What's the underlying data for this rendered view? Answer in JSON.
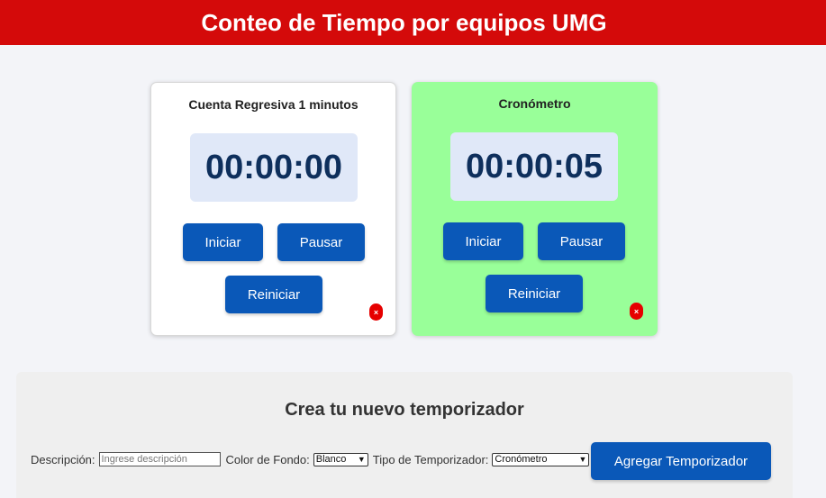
{
  "header": {
    "title": "Conteo de Tiempo por equipos UMG"
  },
  "timers": [
    {
      "title": "Cuenta Regresiva 1 minutos",
      "time": "00:00:00",
      "start_label": "Iniciar",
      "pause_label": "Pausar",
      "reset_label": "Reiniciar",
      "close_label": "×",
      "background": "#ffffff"
    },
    {
      "title": "Cronómetro",
      "time": "00:00:05",
      "start_label": "Iniciar",
      "pause_label": "Pausar",
      "reset_label": "Reiniciar",
      "close_label": "×",
      "background": "#99ff99"
    }
  ],
  "creator": {
    "title": "Crea tu nuevo temporizador",
    "description_label": "Descripción:",
    "description_placeholder": "Ingrese descripción",
    "description_value": "",
    "bg_label": "Color de Fondo:",
    "bg_selected": "Blanco",
    "type_label": "Tipo de Temporizador:",
    "type_selected": "Cronómetro",
    "add_label": "Agregar Temporizador"
  },
  "colors": {
    "header": "#d40a0a",
    "button": "#0a58b8",
    "display_bg": "#e0e8f8",
    "display_text": "#0e2f5c",
    "close": "#e60000"
  }
}
